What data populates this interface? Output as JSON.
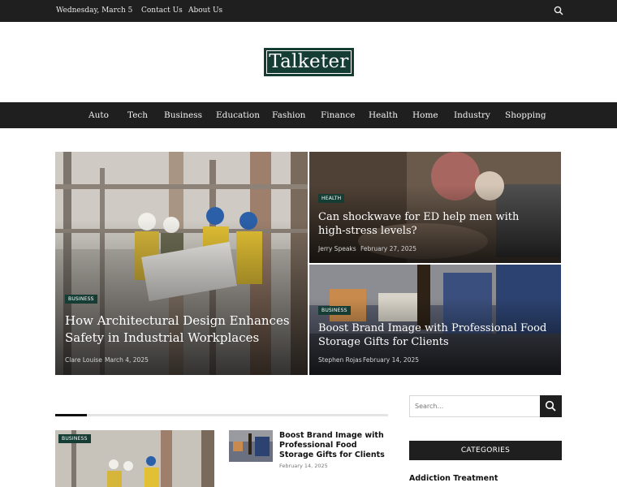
{
  "topbar": {
    "date": "Wednesday, March 5",
    "links": [
      "Contact Us",
      "About Us"
    ],
    "search_icon": "search-icon"
  },
  "logo": {
    "text": "Talketer"
  },
  "nav": {
    "items": [
      "Auto",
      "Tech",
      "Business",
      "Education",
      "Fashion",
      "Finance",
      "Health",
      "Home",
      "Industry",
      "Shopping"
    ]
  },
  "featured": {
    "main": {
      "category": "BUSINESS",
      "title": "How Architectural Design Enhances Safety in Industrial Workplaces",
      "author": "Clare Louise",
      "date": "March 4, 2025"
    },
    "top_right": {
      "category": "HEALTH",
      "title": "Can shockwave for ED help men with high-stress levels?",
      "author": "Jerry Speaks",
      "date": "February 27, 2025"
    },
    "bottom_right": {
      "category": "BUSINESS",
      "title": "Boost Brand Image with Professional Food Storage Gifts for Clients",
      "author": "Stephen Rojas",
      "date": "February 14, 2025"
    }
  },
  "latest": {
    "card_category": "BUSINESS",
    "side_post": {
      "title": "Boost Brand Image with Professional Food Storage Gifts for Clients",
      "date": "February 14, 2025"
    }
  },
  "sidebar": {
    "search_placeholder": "Search...",
    "categories_heading": "CATEGORIES",
    "first_category": "Addiction Treatment"
  },
  "colors": {
    "brand": "#163d34",
    "dark": "#1f1f1f"
  }
}
